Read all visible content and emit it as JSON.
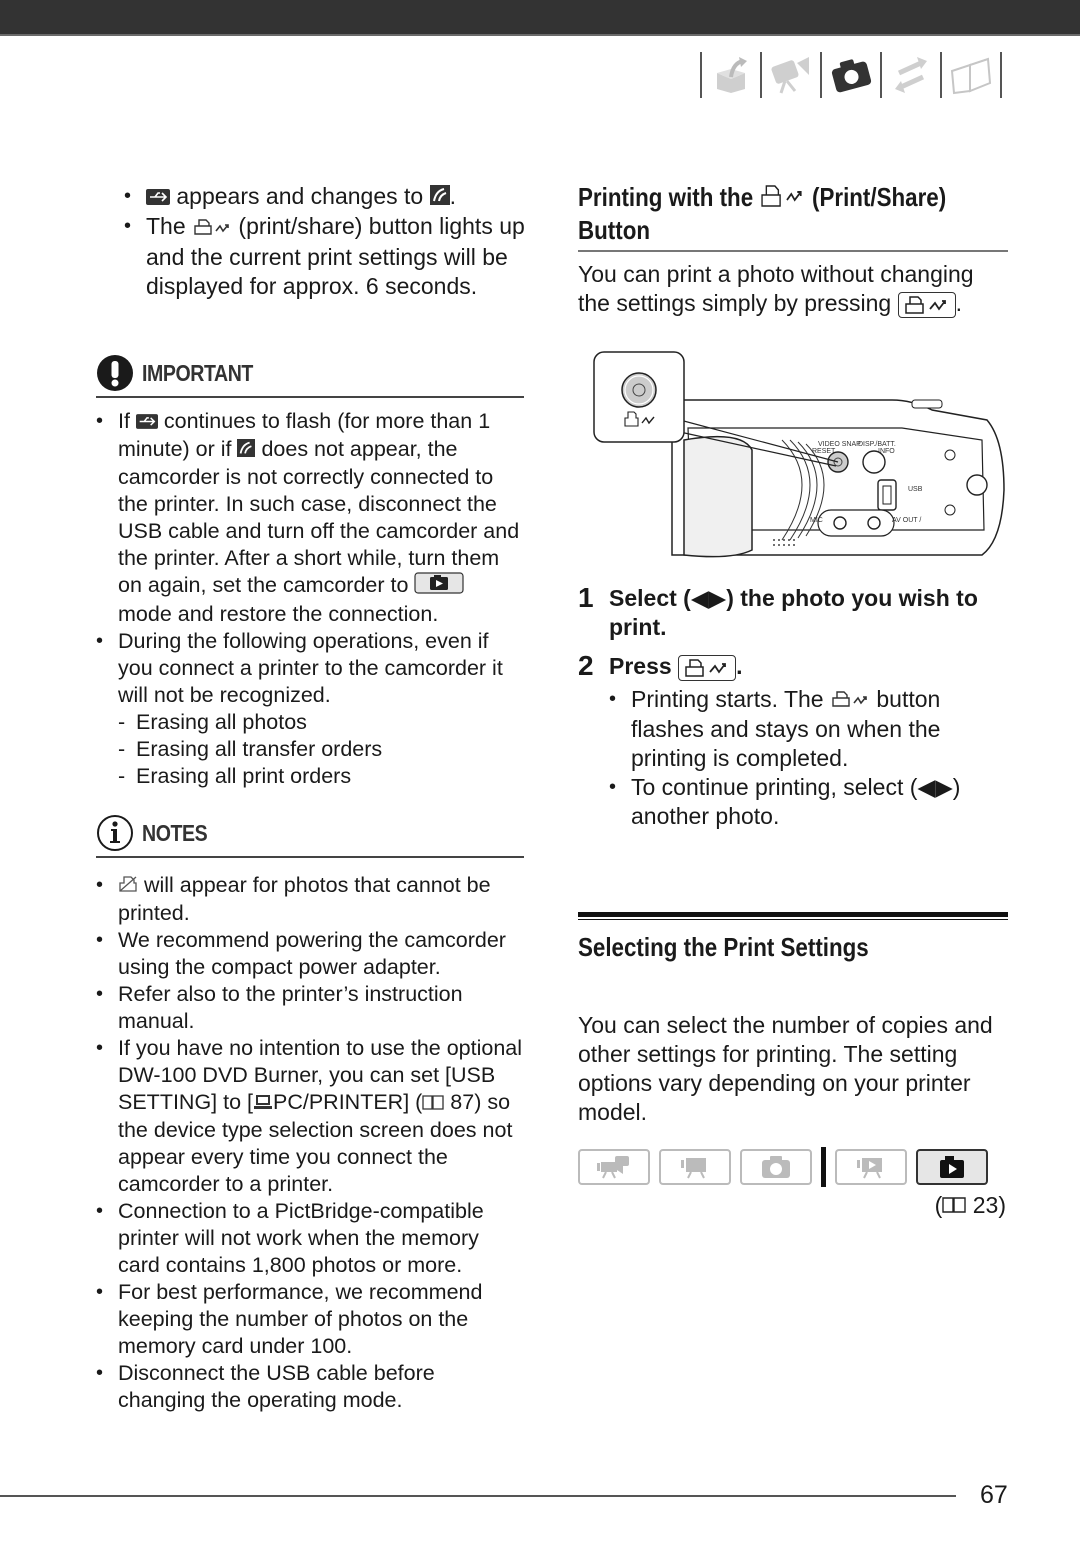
{
  "page": {
    "number": "67",
    "section_tabs": [
      {
        "name": "preparations",
        "icon": "box-arrow-icon",
        "active": false
      },
      {
        "name": "video",
        "icon": "video-camera-icon",
        "active": false
      },
      {
        "name": "photos",
        "icon": "camera-icon",
        "active": true
      },
      {
        "name": "external-connections",
        "icon": "arrows-exchange-icon",
        "active": false
      },
      {
        "name": "additional-info",
        "icon": "book-icon",
        "active": false
      }
    ]
  },
  "left": {
    "intro_bullets": [
      {
        "pre": "",
        "icon1": "usb-icon",
        "mid": " appears and changes to ",
        "icon2": "pictbridge-icon",
        "post": "."
      },
      {
        "pre": "The ",
        "icon": "print-share-icon",
        "post": " (print/share) button lights up and the current print settings will be displayed for approx. 6 seconds."
      }
    ],
    "important": {
      "label": "IMPORTANT",
      "items": [
        {
          "t1": "If ",
          "t2": " continues to flash (for more than 1 minute) or if ",
          "t3": " does not appear, the camcorder is not correctly connected to the printer. In such case, disconnect the USB cable and turn off the camcorder and the printer. After a short while, turn them on again, set the camcorder to ",
          "t4": " mode and restore the connection."
        },
        {
          "text": "During the following operations, even if you connect a printer to the camcorder it will not be recognized.",
          "subitems": [
            "Erasing all photos",
            "Erasing all transfer orders",
            "Erasing all print orders"
          ]
        }
      ]
    },
    "notes": {
      "label": "NOTES",
      "items": [
        {
          "pre": "",
          "icon": "cannot-print-icon",
          "post": " will appear for photos that cannot be printed."
        },
        {
          "text": "We recommend powering the camcorder using the compact power adapter."
        },
        {
          "text": "Refer also to the printer’s instruction manual."
        },
        {
          "pre": "If you have no intention to use the optional DW-100 DVD Burner, you can set [USB SETTING] to [",
          "icon": "computer-icon",
          "mid": "PC/PRINTER] (",
          "ref_icon": "book-ref-icon",
          "post": " 87) so the device type selection screen does not appear every time you connect the camcorder to a printer."
        },
        {
          "text": "Connection to a PictBridge-compatible printer will not work when the memory card contains 1,800 photos or more."
        },
        {
          "text": "For best performance, we recommend keeping the number of photos on the memory card under 100."
        },
        {
          "text": "Disconnect the USB cable before changing the operating mode."
        }
      ]
    }
  },
  "right": {
    "section1": {
      "title_pre": "Printing with the ",
      "title_post": " (Print/Share) Button",
      "intro_pre": "You can print a photo without changing the settings simply by pressing ",
      "intro_post": "."
    },
    "figure": {
      "labels": {
        "video_snap": "VIDEO SNAP",
        "reset": "RESET",
        "disp": "DISP./BATT.",
        "info": "INFO",
        "usb": "USB",
        "mic": "MIC",
        "avout": "AV OUT /"
      }
    },
    "steps": [
      {
        "num": "1",
        "text": "Select (◀▶) the photo you wish to print."
      },
      {
        "num": "2",
        "text_pre": "Press ",
        "text_post": ".",
        "bullets": [
          {
            "pre": "Printing starts. The ",
            "post": " button flashes and stays on when the printing is completed."
          },
          {
            "text": "To continue printing, select (◀▶) another photo."
          }
        ]
      }
    ],
    "section2": {
      "title": "Selecting the Print Settings",
      "body": "You can select the number of copies and other settings for printing. The setting options vary depending on your printer model.",
      "modes": [
        {
          "name": "dual-shot",
          "active": false
        },
        {
          "name": "video-record",
          "active": false
        },
        {
          "name": "photo-record",
          "active": false
        },
        {
          "name": "video-playback",
          "active": false
        },
        {
          "name": "photo-playback",
          "active": true
        }
      ],
      "ref": "23"
    }
  }
}
